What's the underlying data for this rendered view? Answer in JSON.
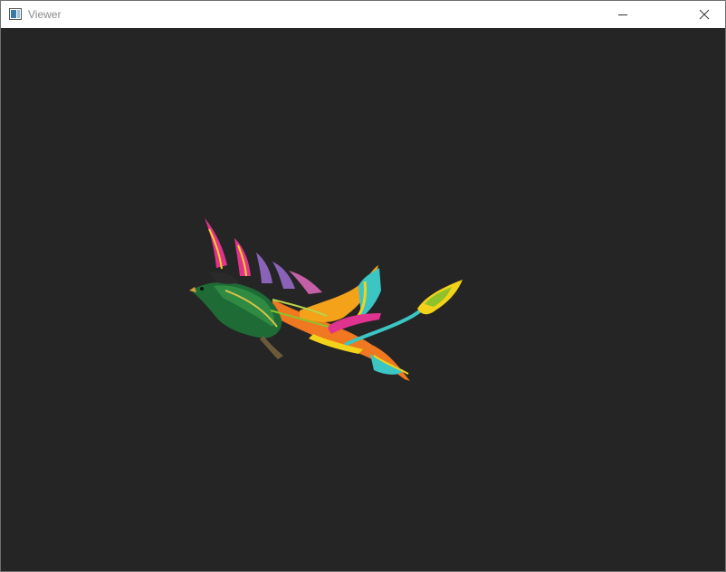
{
  "window": {
    "title": "Viewer",
    "icons": {
      "app": "viewer-app-icon",
      "minimize": "minimize-icon",
      "close": "close-icon"
    }
  },
  "viewport": {
    "background": "#252525",
    "content": "phoenix-3d-model",
    "palette": {
      "crest_magenta": "#e0338f",
      "crest_purple": "#8a63b8",
      "body_green": "#1f6b35",
      "wing_orange": "#f07820",
      "flame_yellow": "#f3d21a",
      "accent_cyan": "#3bc6c4"
    }
  }
}
